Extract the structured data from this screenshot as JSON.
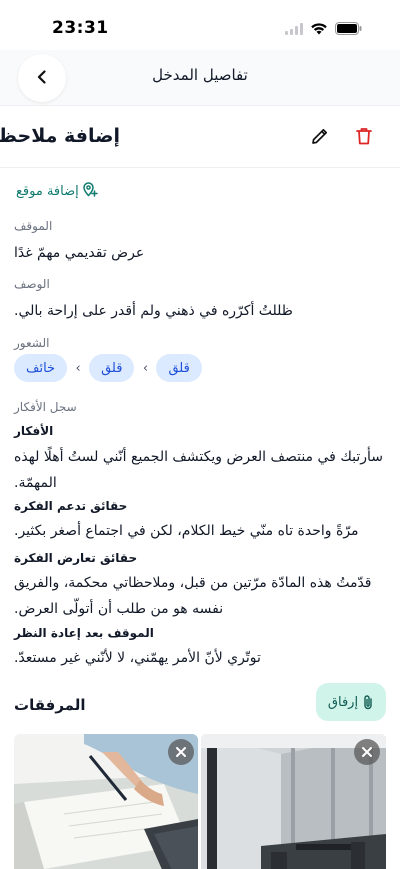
{
  "status_bar": {
    "time": "23:31"
  },
  "header": {
    "title": "تفاصيل المدخل"
  },
  "entry": {
    "title": "إضافة ملاحظة"
  },
  "add_location_label": "إضافة موقع",
  "situation": {
    "label": "الموقف",
    "value": "عرض تقديمي مهمّ غدًا"
  },
  "description": {
    "label": "الوصف",
    "value": "ظللتُ أكرّره في ذهني ولم أقدر على إراحة بالي."
  },
  "feelings": {
    "label": "الشعور",
    "chips": [
      "قلق",
      "قلق",
      "خائف"
    ]
  },
  "thought_log": {
    "label": "سجل الأفكار",
    "thoughts_heading": "الأفكار",
    "thoughts_value": "سأرتبك في منتصف العرض ويكتشف الجميع أنّني لستُ أهلًا لهذه المهمّة.",
    "support_heading": "حقائق تدعم الفكرة",
    "support_value": "مرّةً واحدة تاه منّي خيط الكلام، لكن في اجتماع أصغر بكثير.",
    "against_heading": "حقائق تعارض الفكرة",
    "against_value": "قدّمتُ هذه المادّة مرّتين من قبل، وملاحظاتي محكمة، والفريق نفسه هو من طلب أن أتولّى العرض.",
    "reframe_heading": "الموقف بعد إعادة النظر",
    "reframe_value": "توتّري لأنّ الأمر يهمّني، لا لأنّني غير مستعدّ."
  },
  "attachments": {
    "title": "المرفقات",
    "attach_button": "إرفاق",
    "items": [
      {
        "name": "writing-notebook-photo"
      },
      {
        "name": "office-room-photo"
      }
    ]
  },
  "colors": {
    "accent": "#0f7a6e",
    "delete": "#dc2626",
    "chip_bg": "#dbeafe",
    "chip_text": "#1d4ed8",
    "attach_bg": "#d1f4ea"
  }
}
